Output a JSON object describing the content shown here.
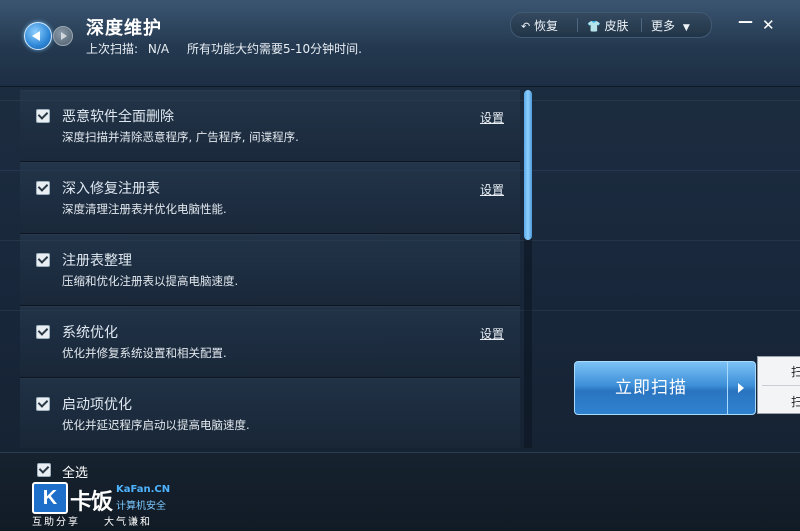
{
  "header": {
    "title": "深度维护",
    "last_scan_label": "上次扫描:",
    "last_scan_value": "N/A",
    "scan_note": "所有功能大约需要5-10分钟时间."
  },
  "top_menu": {
    "restore": "恢复",
    "skin": "皮肤",
    "more": "更多"
  },
  "window_controls": {
    "minimize": "—",
    "close": "✕"
  },
  "items": [
    {
      "title": "恶意软件全面删除",
      "desc": "深度扫描并清除恶意程序, 广告程序, 间谍程序.",
      "setting": "设置",
      "checked": true
    },
    {
      "title": "深入修复注册表",
      "desc": "深度清理注册表并优化电脑性能.",
      "setting": "设置",
      "checked": true
    },
    {
      "title": "注册表整理",
      "desc": "压缩和优化注册表以提高电脑速度.",
      "setting": "",
      "checked": true
    },
    {
      "title": "系统优化",
      "desc": "优化并修复系统设置和相关配置.",
      "setting": "设置",
      "checked": true
    },
    {
      "title": "启动项优化",
      "desc": "优化并延迟程序启动以提高电脑速度.",
      "setting": "",
      "checked": true
    }
  ],
  "select_all": "全选",
  "scan_button": "立即扫描",
  "popup": {
    "item1": "扫",
    "item2": "扫"
  },
  "logo": {
    "mark": "K",
    "name": "卡饭",
    "domain": "KaFan.CN",
    "tagline": "计算机安全",
    "bottom1": "互助分享",
    "bottom2": "大气谦和"
  }
}
